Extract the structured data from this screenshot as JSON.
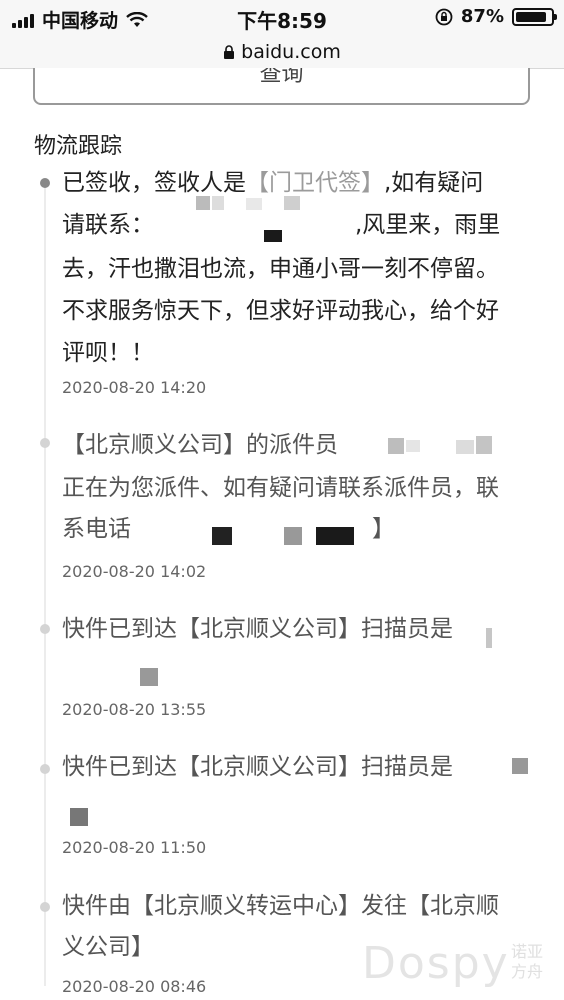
{
  "status_bar": {
    "carrier": "中国移动",
    "time": "下午8:59",
    "battery_percent": "87%",
    "battery_level": 0.87
  },
  "url_bar": {
    "domain": "baidu.com"
  },
  "query_button": {
    "label": "查询"
  },
  "tracking": {
    "title": "物流跟踪",
    "entries": [
      {
        "lines": [
          "已签收，签收人是【门卫代签】,如有疑问",
          "请联系：",
          ",风里来，雨里",
          "去，汗也撒泪也流，申通小哥一刻不停留。",
          "不求服务惊天下，但求好评动我心，给个好",
          "评呗！！"
        ],
        "time": "2020-08-20 14:20"
      },
      {
        "lines": [
          "【北京顺义公司】的派件员",
          "正在为您派件、如有疑问请联系派件员，联",
          "系电话",
          "】"
        ],
        "time": "2020-08-20 14:02"
      },
      {
        "lines": [
          "快件已到达【北京顺义公司】扫描员是"
        ],
        "time": "2020-08-20 13:55"
      },
      {
        "lines": [
          "快件已到达【北京顺义公司】扫描员是"
        ],
        "time": "2020-08-20 11:50"
      },
      {
        "lines": [
          "快件由【北京顺义转运中心】发往【北京顺",
          "义公司】"
        ],
        "time": "2020-08-20 08:46"
      }
    ]
  },
  "watermark": {
    "latin": "Dospy",
    "cjk": "诺亚方舟"
  }
}
